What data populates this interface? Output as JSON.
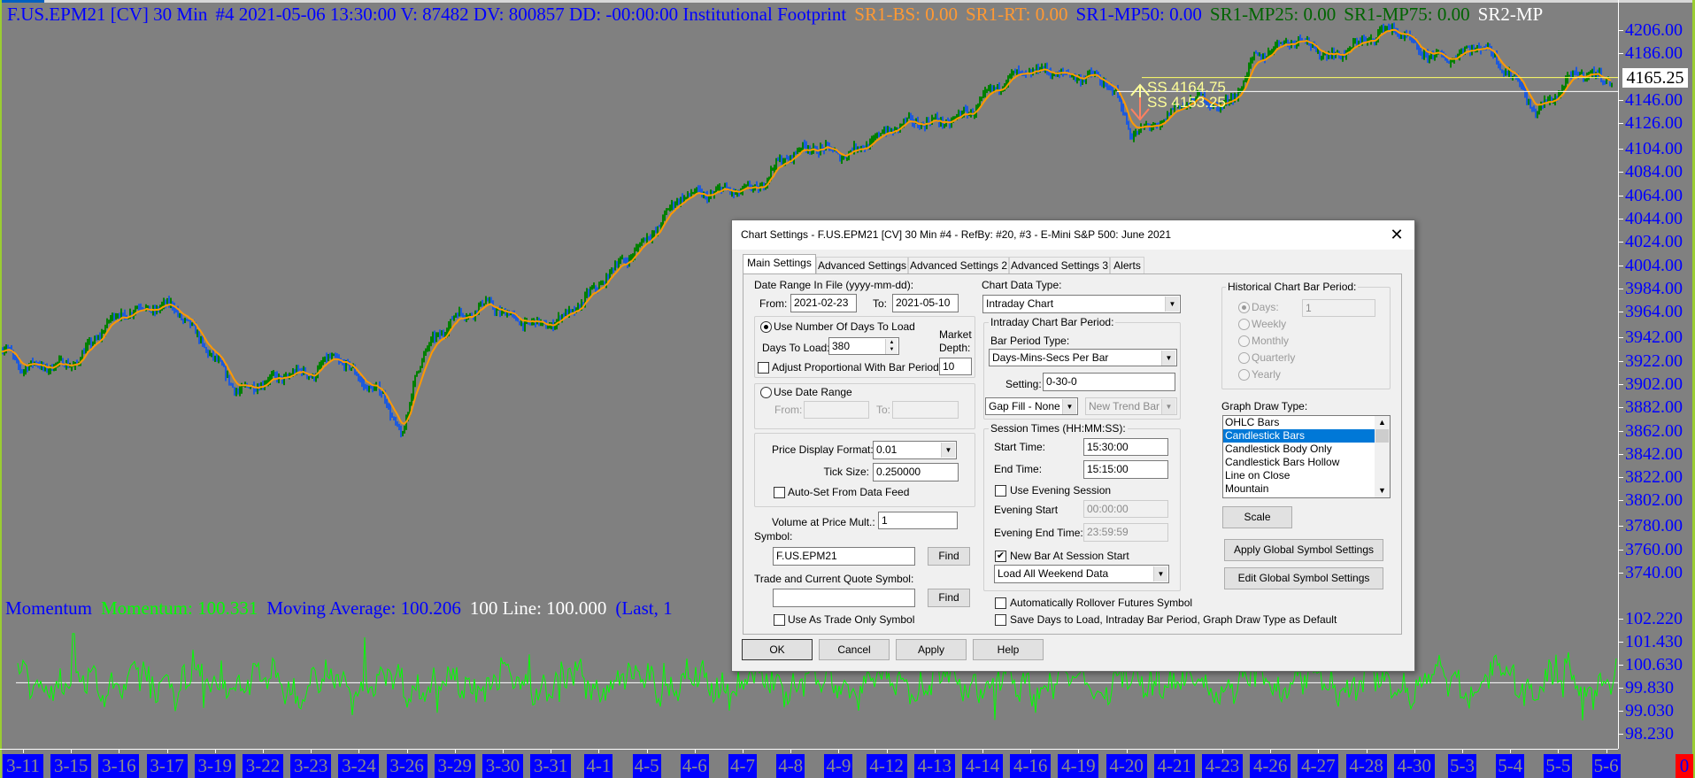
{
  "header": {
    "items": [
      {
        "text": "F.US.EPM21 [CV]  30 Min",
        "color": "#0000ff"
      },
      {
        "text": "#4 2021-05-06 13:30:00 V: 87482 DV: 800857 DD: -00:00:00 Institutional Footprint",
        "color": "#0000ff"
      },
      {
        "text": "SR1-BS: 0.00",
        "color": "#ff9933"
      },
      {
        "text": "SR1-RT: 0.00",
        "color": "#ff9933"
      },
      {
        "text": "SR1-MP50: 0.00",
        "color": "#0000ff"
      },
      {
        "text": "SR1-MP25: 0.00",
        "color": "#006400"
      },
      {
        "text": "SR1-MP75: 0.00",
        "color": "#006400"
      },
      {
        "text": "SR2-MP",
        "color": "#ffffff"
      }
    ]
  },
  "momentum_header": {
    "items": [
      {
        "text": "Momentum",
        "color": "#0000ff"
      },
      {
        "text": "Momentum: 100.331",
        "color": "#00ff00"
      },
      {
        "text": "Moving Average: 100.206",
        "color": "#0000ff"
      },
      {
        "text": "100 Line: 100.000",
        "color": "#ffffff"
      },
      {
        "text": "(Last, 1",
        "color": "#0000ff"
      }
    ]
  },
  "price_axis": {
    "labels": [
      "4206.00",
      "4186.00",
      "4146.00",
      "4126.00",
      "4104.00",
      "4084.00",
      "4064.00",
      "4044.00",
      "4024.00",
      "4004.00",
      "3984.00",
      "3964.00",
      "3942.00",
      "3922.00",
      "3902.00",
      "3882.00",
      "3862.00",
      "3842.00",
      "3822.00",
      "3802.00",
      "3780.00",
      "3760.00",
      "3740.00"
    ],
    "current_price": "4165.25"
  },
  "momentum_axis": {
    "labels": [
      "102.220",
      "101.430",
      "100.630",
      "99.830",
      "99.030",
      "98.230"
    ]
  },
  "date_axis": {
    "labels": [
      "3-11",
      "3-15",
      "3-16",
      "3-17",
      "3-19",
      "3-22",
      "3-23",
      "3-24",
      "3-26",
      "3-29",
      "3-30",
      "3-31",
      "4-1",
      "4-5",
      "4-6",
      "4-7",
      "4-8",
      "4-9",
      "4-12",
      "4-13",
      "4-14",
      "4-16",
      "4-19",
      "4-20",
      "4-21",
      "4-23",
      "4-26",
      "4-27",
      "4-28",
      "4-30",
      "5-3",
      "5-4",
      "5-5",
      "5-6"
    ],
    "counter": "0"
  },
  "annotations": {
    "ss_high": "SS  4164.75",
    "ss_low": "SS  4153.25",
    "ss_high_price": 4165.25,
    "ss_low_price": 4153.25
  },
  "chart_data": {
    "type": "line",
    "title": "F.US.EPM21 [CV] 30 Min",
    "price_range": [
      3740,
      4206
    ],
    "momentum_range": [
      98.23,
      102.22
    ],
    "momentum_baseline": 100,
    "price_path": [
      [
        -0.39,
        3930
      ],
      [
        -0.05,
        3912
      ],
      [
        0.4,
        3916
      ],
      [
        1.08,
        3925
      ],
      [
        1.75,
        3953
      ],
      [
        2.54,
        3967
      ],
      [
        3.1,
        3974
      ],
      [
        3.44,
        3953
      ],
      [
        4.01,
        3916
      ],
      [
        4.46,
        3893
      ],
      [
        4.91,
        3907
      ],
      [
        5.47,
        3912
      ],
      [
        6.03,
        3907
      ],
      [
        6.48,
        3925
      ],
      [
        6.93,
        3912
      ],
      [
        7.5,
        3893
      ],
      [
        7.88,
        3851
      ],
      [
        8.17,
        3912
      ],
      [
        8.51,
        3937
      ],
      [
        8.96,
        3963
      ],
      [
        9.64,
        3972
      ],
      [
        10.2,
        3953
      ],
      [
        10.77,
        3953
      ],
      [
        11.22,
        3963
      ],
      [
        11.89,
        3981
      ],
      [
        12.57,
        4009
      ],
      [
        13.02,
        4032
      ],
      [
        13.36,
        4051
      ],
      [
        13.69,
        4065
      ],
      [
        14.14,
        4060
      ],
      [
        14.82,
        4069
      ],
      [
        15.27,
        4074
      ],
      [
        15.72,
        4093
      ],
      [
        16.4,
        4102
      ],
      [
        17.07,
        4102
      ],
      [
        17.52,
        4111
      ],
      [
        18.2,
        4120
      ],
      [
        19.1,
        4130
      ],
      [
        19.78,
        4139
      ],
      [
        20.23,
        4153
      ],
      [
        20.9,
        4171
      ],
      [
        21.35,
        4176
      ],
      [
        21.8,
        4167
      ],
      [
        22.26,
        4162
      ],
      [
        22.71,
        4153
      ],
      [
        23.04,
        4120
      ],
      [
        23.38,
        4125
      ],
      [
        23.72,
        4130
      ],
      [
        24.06,
        4139
      ],
      [
        24.51,
        4144
      ],
      [
        24.96,
        4139
      ],
      [
        25.3,
        4158
      ],
      [
        25.63,
        4185
      ],
      [
        26.09,
        4190
      ],
      [
        26.54,
        4195
      ],
      [
        27.21,
        4185
      ],
      [
        27.66,
        4195
      ],
      [
        28.12,
        4199
      ],
      [
        28.56,
        4204
      ],
      [
        29.01,
        4190
      ],
      [
        29.69,
        4185
      ],
      [
        30.37,
        4190
      ],
      [
        30.82,
        4171
      ],
      [
        31.15,
        4162
      ],
      [
        31.49,
        4139
      ],
      [
        31.94,
        4153
      ],
      [
        32.39,
        4167
      ],
      [
        32.85,
        4162
      ],
      [
        33.23,
        4165.25
      ]
    ],
    "colors": {
      "up": "#008000",
      "down": "#1e5adc",
      "ma": "#ff9900",
      "momentum": "#00ff00"
    }
  },
  "dialog": {
    "title": "Chart Settings - F.US.EPM21 [CV]  30 Min   #4 - RefBy: #20, #3 - E-Mini S&P 500: June 2021",
    "close": "✕",
    "tabs": [
      "Main Settings",
      "Advanced Settings",
      "Advanced Settings 2",
      "Advanced Settings 3",
      "Alerts"
    ],
    "date_range_label": "Date Range In File (yyyy-mm-dd):",
    "from_label": "From:",
    "from_value": "2021-02-23",
    "to_label": "To:",
    "to_value": "2021-05-10",
    "use_days_label": "Use Number Of Days To Load",
    "days_to_load_label": "Days To Load:",
    "days_to_load_value": "380",
    "market_label": "Market",
    "depth_label": "Depth:",
    "depth_value": "10",
    "adjust_label": "Adjust Proportional With Bar Period",
    "use_date_range_label": "Use Date Range",
    "dr_from_label": "From:",
    "dr_to_label": "To:",
    "price_format_label": "Price Display Format:",
    "price_format_value": "0.01",
    "tick_size_label": "Tick Size:",
    "tick_size_value": "0.250000",
    "auto_set_label": "Auto-Set From Data Feed",
    "vap_label": "Volume at Price Mult.:",
    "vap_value": "1",
    "symbol_label": "Symbol:",
    "symbol_value": "F.US.EPM21",
    "find_label": "Find",
    "trade_symbol_label": "Trade and Current Quote Symbol:",
    "trade_symbol_value": "",
    "trade_only_label": "Use As Trade Only Symbol",
    "chart_data_type_label": "Chart Data Type:",
    "chart_data_type_value": "Intraday Chart",
    "intraday_group_label": "Intraday Chart Bar Period:",
    "bar_period_type_label": "Bar Period Type:",
    "bar_period_type_value": "Days-Mins-Secs Per Bar",
    "setting_label": "Setting:",
    "setting_value": "0-30-0",
    "gap_fill_value": "Gap Fill - None",
    "new_trend_value": "New Trend Bar W",
    "session_group_label": "Session Times (HH:MM:SS):",
    "start_time_label": "Start Time:",
    "start_time_value": "15:30:00",
    "end_time_label": "End Time:",
    "end_time_value": "15:15:00",
    "use_evening_label": "Use Evening Session",
    "evening_start_label": "Evening Start",
    "evening_start_value": "00:00:00",
    "evening_end_label": "Evening End Time:",
    "evening_end_value": "23:59:59",
    "new_bar_label": "New Bar At Session Start",
    "weekend_value": "Load All Weekend Data",
    "rollover_label": "Automatically Rollover Futures Symbol",
    "save_default_label": "Save Days to Load, Intraday Bar Period, Graph Draw Type as Default",
    "historical_group_label": "Historical Chart Bar Period:",
    "hist_days_label": "Days:",
    "hist_days_value": "1",
    "hist_weekly": "Weekly",
    "hist_monthly": "Monthly",
    "hist_quarterly": "Quarterly",
    "hist_yearly": "Yearly",
    "graph_draw_label": "Graph Draw Type:",
    "graph_draw_options": [
      "OHLC Bars",
      "Candlestick Bars",
      "Candlestick Body Only",
      "Candlestick Bars Hollow",
      "Line on Close",
      "Mountain"
    ],
    "graph_draw_selected": "Candlestick Bars",
    "scale_label": "Scale",
    "apply_global_label": "Apply Global Symbol Settings",
    "edit_global_label": "Edit Global Symbol Settings",
    "ok_label": "OK",
    "cancel_label": "Cancel",
    "apply_label": "Apply",
    "help_label": "Help"
  }
}
